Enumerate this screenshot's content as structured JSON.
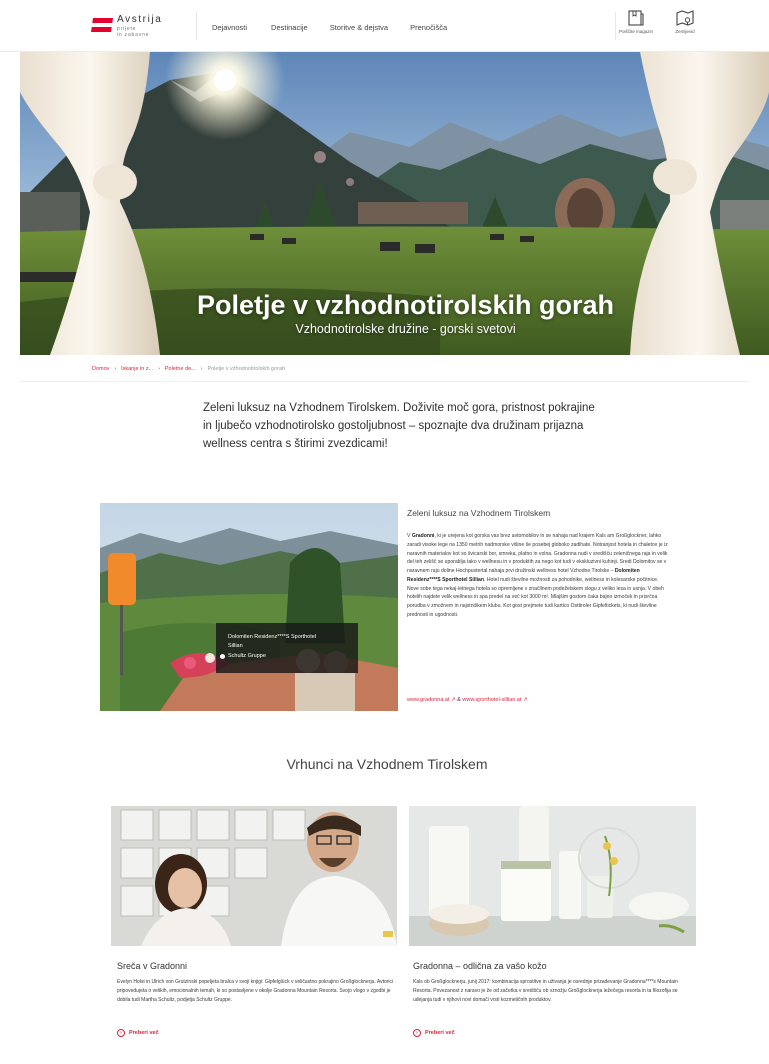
{
  "header": {
    "logo_name": "Avstrija",
    "logo_sub1": "prijete",
    "logo_sub2": "in zabavne",
    "nav": [
      "Dejavnosti",
      "Destinacije",
      "Storitve & dejstva",
      "Prenočišča"
    ],
    "tools": [
      {
        "label": "Poiščite magazin",
        "icon": "magazine-icon"
      },
      {
        "label": "Zemljevid",
        "icon": "map-pin-icon"
      }
    ]
  },
  "hero": {
    "title": "Poletje v vzhodnotirolskih gorah",
    "subtitle": "Vzhodnotirolske družine - gorski svetovi"
  },
  "breadcrumb": {
    "items": [
      "Domov",
      "Iskanje in z...",
      "Poletne de...",
      "Poletje v vzhodnotirolskih gorah"
    ]
  },
  "intro": "Zeleni luksuz na Vzhodnem Tirolskem. Doživite moč gora, pristnost pokrajine in ljubečo vzhodnotirolsko gostoljubnost – spoznajte dva družinam prijazna wellness centra s štirimi zvezdicami!",
  "feature": {
    "title": "Zeleni luksuz na Vzhodnem Tirolskem",
    "body_1": "V ",
    "body_bold_1": "Gradonni",
    "body_2": ", ki je urejena kot gorska vas brez avtomobilov in se nahaja nad krajem Kals am Großglockner, lahko zaradi visoke lege na 1350 metrih nadmorske višine še posebej globoko zadihate. Notranjost hotela in chaletov je iz naravnih materialov kot so švicarski bor, smreka, platno in volna. Gradonna nudi v središču zeleničnega raja in velik del teh zelišč se uporablja tako v wellnesu in v produktih za nego kot tudi v ekskluzivni kuhinji. Sredi Dolomitov se v naravnem raju doline Hochpustertal nahaja prvi družinski wellness hotel Vzhodne Tirolske – ",
    "body_bold_2": "Dolomiten Residenz****S Sporthotel Sillian",
    "body_3": ". Hotel nudi številne možnosti za pohodnike, wellness in kolesarske počitnice. Nove sobe tega nekaj-letnega hotela so opremljene v značilnem podeželskem slogu z veliko lesa in usnja. V obeh hotelih najdete velik wellness in spa predel na več kot 3000 m². Mlajšim gostom čaka bajno izmoček in prisrčna porudba v zmožnem in najstniškem klubu. Kot gost prejmete tudi kartico Osttiroler Gipfeltickets, ki nudi številne prednosti in ugodnosti.",
    "caption_line1": "Dolomiten Residenz****S Sporthotel",
    "caption_line2": "Sillian",
    "caption_source": "Schultz Gruppe",
    "link1": "www.gradonna.at ↗",
    "link_amp": " & ",
    "link2": "www.sporthotel-sillian.at ↗"
  },
  "highlights": {
    "title": "Vrhunci na Vzhodnem Tirolskem",
    "cards": [
      {
        "title": "Sreča v Gradonni",
        "body": "Evelyn Holst in Ulrich von Grutzinski popeljeta bralca v svoji knjigi: Gipfelglück v veličastno pokrajino Großglocknerja. Avtorici pripovedujeta o velikih, emocionalnih temah, ki so postavljene v okolje Gradonna Mountain Resorta. Svojo vlogo v zgodbi je dobila tudi Martha Schultz, podjetja Schultz Gruppe.",
        "more": "Preberi več"
      },
      {
        "title": "Gradonna – odlična za vašo kožo",
        "body": "Kals ob Großglocknerju, junij 2017: kombinacija sprostitve in uživanja je osrednje prizadevanje Gradonna****s Mountain Resorta. Povezanost z naravo je že od začetka v središču ob vznožju Großglocknerja ležečega resorta in ta filozofija se udejanja tudi v njihovi novi domači vrsti kozmetičnih produktov.",
        "more": "Preberi več"
      }
    ]
  },
  "colors": {
    "accent": "#d6243a",
    "flag_red": "#e4032e"
  }
}
